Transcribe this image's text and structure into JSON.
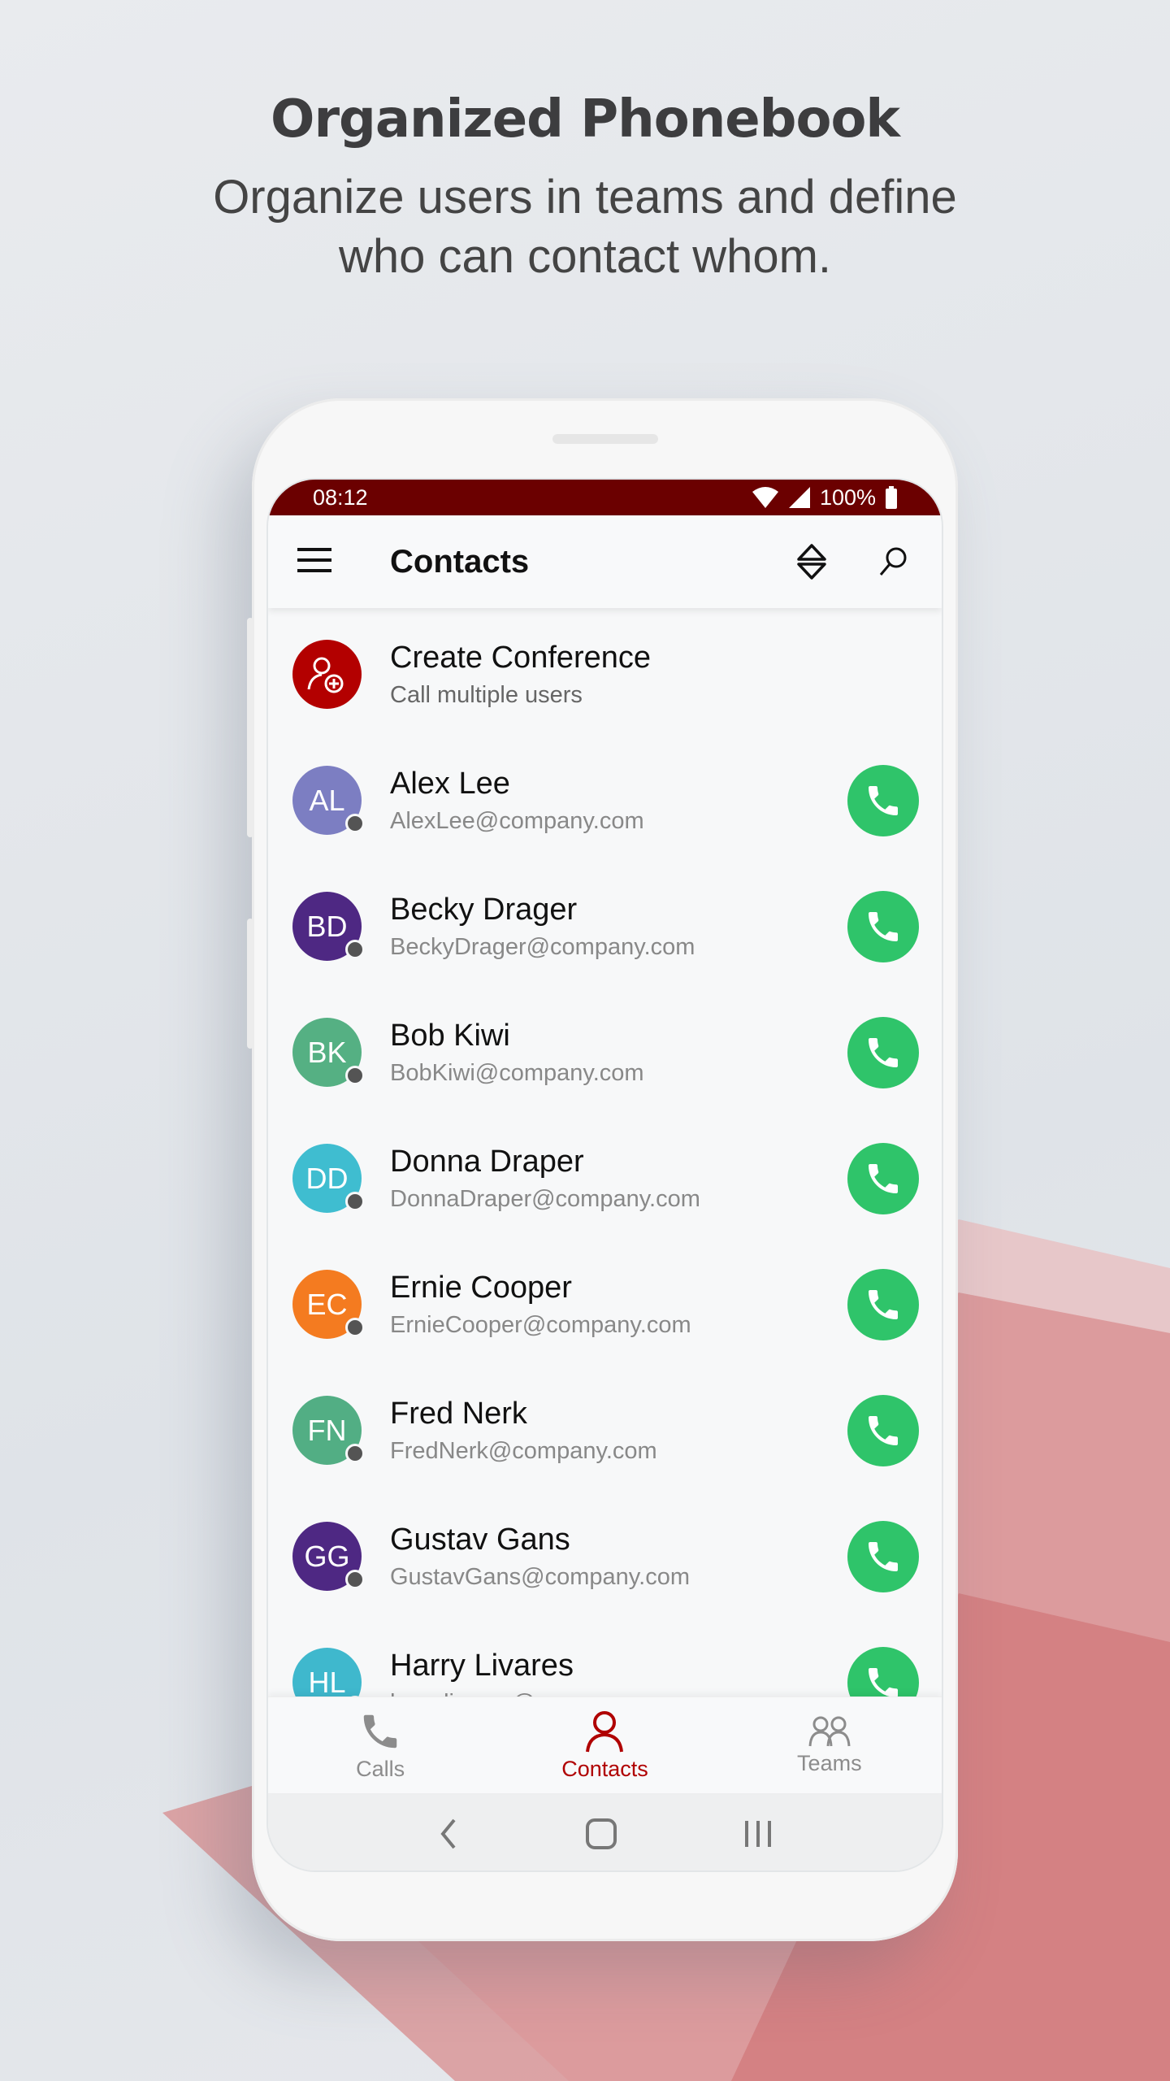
{
  "hero": {
    "title": "Organized Phonebook",
    "subtitle_line1": "Organize users in teams and define",
    "subtitle_line2": "who can contact whom."
  },
  "status": {
    "time": "08:12",
    "battery": "100%",
    "accent": "#6b0000"
  },
  "appbar": {
    "title": "Contacts",
    "icons": [
      "menu-icon",
      "sort-icon",
      "search-icon"
    ]
  },
  "conference": {
    "title": "Create Conference",
    "subtitle": "Call multiple users",
    "color": "#b30000"
  },
  "contacts": [
    {
      "initials": "AL",
      "name": "Alex Lee",
      "email": "AlexLee@company.com",
      "color": "#7c7ec2"
    },
    {
      "initials": "BD",
      "name": "Becky Drager",
      "email": "BeckyDrager@company.com",
      "color": "#4e2883"
    },
    {
      "initials": "BK",
      "name": "Bob Kiwi",
      "email": "BobKiwi@company.com",
      "color": "#55b083"
    },
    {
      "initials": "DD",
      "name": "Donna Draper",
      "email": "DonnaDraper@company.com",
      "color": "#3fbdd0"
    },
    {
      "initials": "EC",
      "name": "Ernie Cooper",
      "email": "ErnieCooper@company.com",
      "color": "#f47b20"
    },
    {
      "initials": "FN",
      "name": "Fred Nerk",
      "email": "FredNerk@company.com",
      "color": "#52ae84"
    },
    {
      "initials": "GG",
      "name": "Gustav Gans",
      "email": "GustavGans@company.com",
      "color": "#4e2883"
    },
    {
      "initials": "HL",
      "name": "Harry Livares",
      "email": "harrylivares@company.com",
      "color": "#3fb8cd"
    }
  ],
  "bottom_nav": [
    {
      "label": "Calls",
      "active": false
    },
    {
      "label": "Contacts",
      "active": true
    },
    {
      "label": "Teams",
      "active": false
    }
  ],
  "call_color": "#2fc46a"
}
